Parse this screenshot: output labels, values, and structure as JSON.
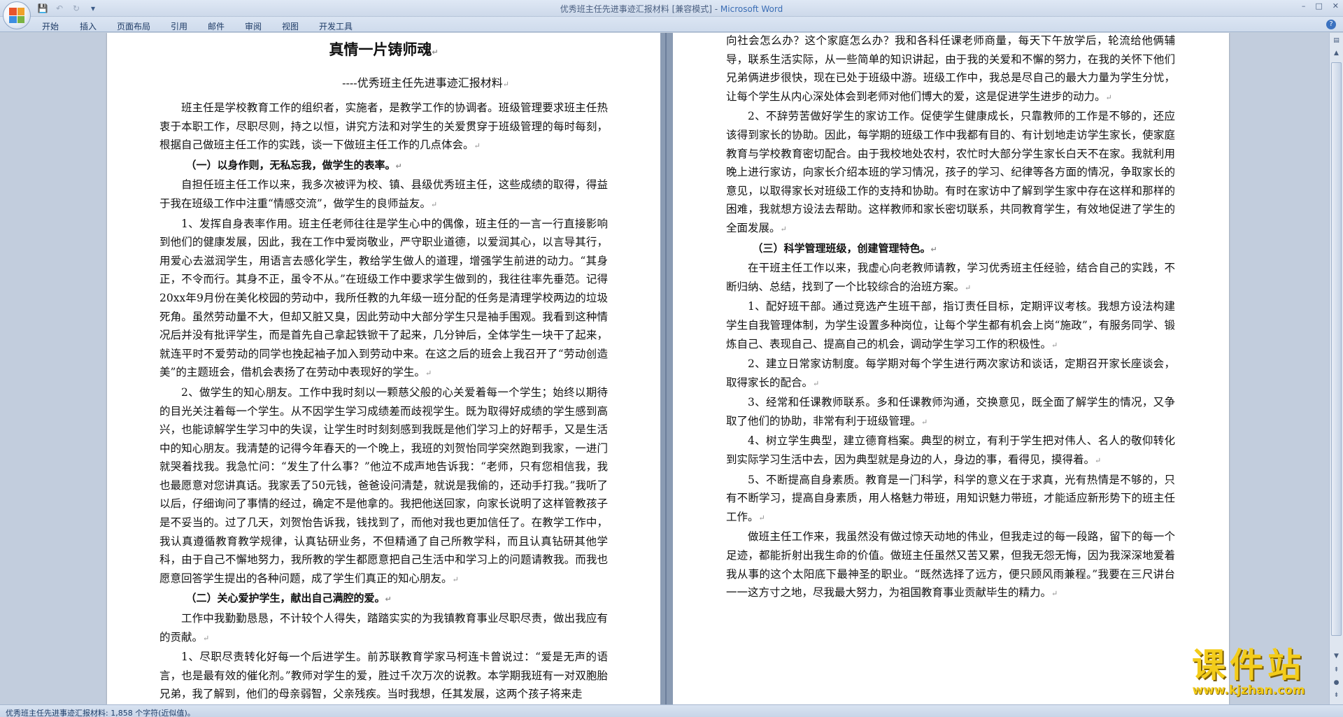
{
  "window": {
    "title": "优秀班主任先进事迹汇报材料 [兼容模式] - ",
    "app_name": "Microsoft Word"
  },
  "ribbon_tabs": [
    "开始",
    "插入",
    "页面布局",
    "引用",
    "邮件",
    "审阅",
    "视图",
    "开发工具"
  ],
  "document": {
    "title": "真情一片铸师魂",
    "subtitle": "----优秀班主任先进事迹汇报材料",
    "page1": [
      {
        "type": "para",
        "text": "班主任是学校教育工作的组织者，实施者，是教学工作的协调者。班级管理要求班主任热衷于本职工作，尽职尽则，持之以恒，讲究方法和对学生的关爱贯穿于班级管理的每时每刻，根据自己做班主任工作的实践，谈一下做班主任工作的几点体会。"
      },
      {
        "type": "heading",
        "text": "（一）以身作则，无私忘我，做学生的表率。"
      },
      {
        "type": "para",
        "text": "自担任班主任工作以来，我多次被评为校、镇、县级优秀班主任，这些成绩的取得，得益于我在班级工作中注重“情感交流”，做学生的良师益友。"
      },
      {
        "type": "para",
        "text": "1、发挥自身表率作用。班主任老师往往是学生心中的偶像，班主任的一言一行直接影响到他们的健康发展，因此，我在工作中爱岗敬业，严守职业道德，以爱润其心，以言导其行，用爱心去滋润学生，用语言去感化学生，教给学生做人的道理，增强学生前进的动力。“其身正，不令而行。其身不正，虽令不从。”在班级工作中要求学生做到的，我往往率先垂范。记得20xx年9月份在美化校园的劳动中，我所任教的九年级一班分配的任务是清理学校两边的垃圾死角。虽然劳动量不大，但却又脏又臭，因此劳动中大部分学生只是袖手围观。我看到这种情况后并没有批评学生，而是首先自己拿起铁锨干了起来，几分钟后，全体学生一块干了起来，就连平时不爱劳动的同学也挽起袖子加入到劳动中来。在这之后的班会上我召开了“劳动创造美”的主题班会，借机会表扬了在劳动中表现好的学生。"
      },
      {
        "type": "para",
        "text": "2、做学生的知心朋友。工作中我时刻以一颗慈父般的心关爱着每一个学生；始终以期待的目光关注着每一个学生。从不因学生学习成绩差而歧视学生。既为取得好成绩的学生感到高兴，也能谅解学生学习中的失误，让学生时时刻刻感到我既是他们学习上的好帮手，又是生活中的知心朋友。我清楚的记得今年春天的一个晚上，我班的刘贺怡同学突然跑到我家，一进门就哭着找我。我急忙问：“发生了什么事？”他泣不成声地告诉我：“老师，只有您相信我，我也最愿意对您讲真话。我家丢了50元钱，爸爸设问清楚，就说是我偷的，还动手打我。”我听了以后，仔细询问了事情的经过，确定不是他拿的。我把他送回家，向家长说明了这样管教孩子是不妥当的。过了几天，刘贺怡告诉我，钱找到了，而他对我也更加信任了。在教学工作中，我认真遵循教育教学规律，认真钻研业务，不但精通了自己所教学科，而且认真钻研其他学科，由于自己不懈地努力，我所教的学生都愿意把自己生活中和学习上的问题请教我。而我也愿意回答学生提出的各种问题，成了学生们真正的知心朋友。"
      },
      {
        "type": "heading",
        "text": "（二）关心爱护学生，献出自己满腔的爱。"
      },
      {
        "type": "para",
        "text": "工作中我勤勤恳恳，不计较个人得失，踏踏实实的为我镇教育事业尽职尽责，做出我应有的贡献。"
      },
      {
        "type": "para",
        "text": "1、尽职尽责转化好每一个后进学生。前苏联教育学家马柯连卡曾说过：“爱是无声的语言，也是最有效的催化剂。”教师对学生的爱，胜过千次万次的说教。本学期我班有一对双胞胎兄弟，我了解到，他们的母亲弱智，父亲残疾。当时我想，任其发展，这两个孩子将来走"
      }
    ],
    "page2": [
      {
        "type": "flat",
        "text": "向社会怎么办？这个家庭怎么办？我和各科任课老师商量，每天下午放学后，轮流给他俩辅导，联系生活实际，从一些简单的知识讲起，由于我的关爱和不懈的努力，在我的关怀下他们兄弟俩进步很快，现在已处于班级中游。班级工作中，我总是尽自己的最大力量为学生分忧，让每个学生从内心深处体会到老师对他们博大的爱，这是促进学生进步的动力。"
      },
      {
        "type": "para",
        "text": "2、不辞劳苦做好学生的家访工作。促使学生健康成长，只靠教师的工作是不够的，还应该得到家长的协助。因此，每学期的班级工作中我都有目的、有计划地走访学生家长，使家庭教育与学校教育密切配合。由于我校地处农村，农忙时大部分学生家长白天不在家。我就利用晚上进行家访，向家长介绍本班的学习情况，孩子的学习、纪律等各方面的情况，争取家长的意见，以取得家长对班级工作的支持和协助。有时在家访中了解到学生家中存在这样和那样的困难，我就想方设法去帮助。这样教师和家长密切联系，共同教育学生，有效地促进了学生的全面发展。"
      },
      {
        "type": "heading",
        "text": "（三）科学管理班级，创建管理特色。"
      },
      {
        "type": "para",
        "text": "在干班主任工作以来，我虚心向老教师请教，学习优秀班主任经验，结合自己的实践，不断归纳、总结，找到了一个比较综合的治班方案。"
      },
      {
        "type": "para",
        "text": "1、配好班干部。通过竞选产生班干部，指订责任目标，定期评议考核。我想方设法构建学生自我管理体制，为学生设置多种岗位，让每个学生都有机会上岗“施政”，有服务同学、锻炼自己、表现自己、提高自己的机会，调动学生学习工作的积极性。"
      },
      {
        "type": "para",
        "text": "2、建立日常家访制度。每学期对每个学生进行两次家访和谈话，定期召开家长座谈会，取得家长的配合。"
      },
      {
        "type": "para",
        "text": "3、经常和任课教师联系。多和任课教师沟通，交换意见，既全面了解学生的情况，又争取了他们的协助，非常有利于班级管理。"
      },
      {
        "type": "para",
        "text": "4、树立学生典型，建立德育档案。典型的树立，有利于学生把对伟人、名人的敬仰转化到实际学习生活中去，因为典型就是身边的人，身边的事，看得见，摸得着。"
      },
      {
        "type": "para",
        "text": "5、不断提高自身素质。教育是一门科学，科学的意义在于求真，光有热情是不够的，只有不断学习，提高自身素质，用人格魅力带班，用知识魅力带班，才能适应新形势下的班主任工作。"
      },
      {
        "type": "para",
        "text": "做班主任工作来，我虽然没有做过惊天动地的伟业，但我走过的每一段路，留下的每一个足迹，都能折射出我生命的价值。做班主任虽然又苦又累，但我无怨无悔，因为我深深地爱着我从事的这个太阳底下最神圣的职业。“既然选择了远方，便只顾风雨兼程。”我要在三尺讲台一一这方寸之地，尽我最大努力，为祖国教育事业贡献毕生的精力。"
      }
    ]
  },
  "status_bar": {
    "text": "优秀班主任先进事迹汇报材料: 1,858 个字符(近似值)。"
  },
  "watermark": {
    "main": "课件站",
    "url": "www.kjzhan.com"
  },
  "icons": {
    "office_button": "office-logo-icon",
    "save": "save-icon",
    "undo": "undo-icon",
    "redo": "redo-icon",
    "customize": "dropdown-arrow-icon",
    "help": "help-icon"
  }
}
